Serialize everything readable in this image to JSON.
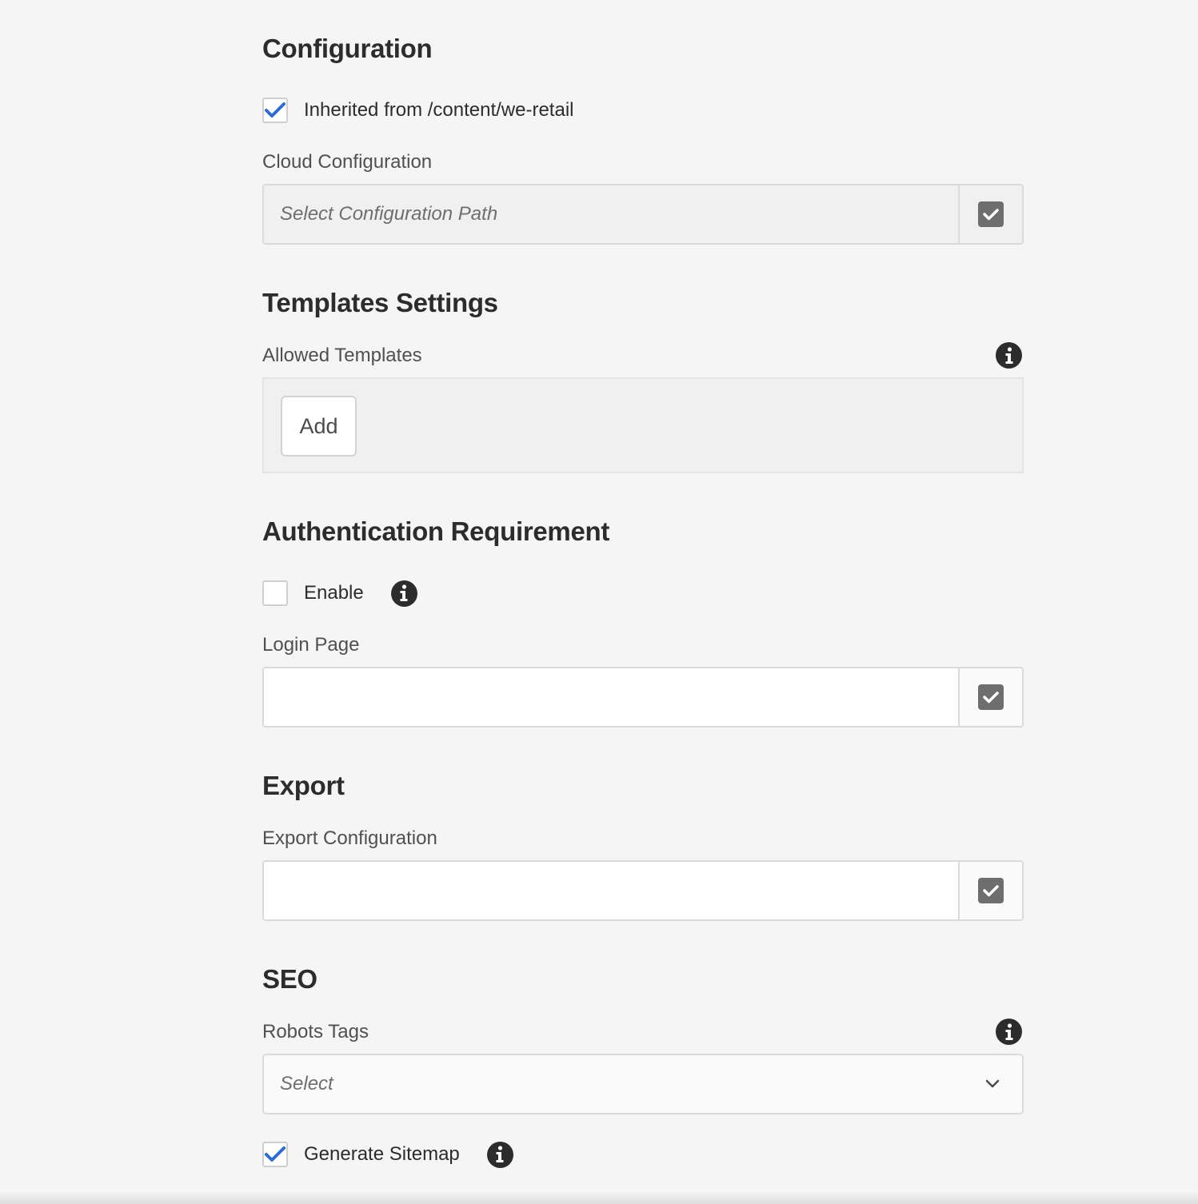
{
  "sections": {
    "configuration": {
      "title": "Configuration",
      "inherited_label": "Inherited from /content/we-retail",
      "inherited_checked": true,
      "cloud_config_label": "Cloud Configuration",
      "cloud_config_placeholder": "Select Configuration Path"
    },
    "templates": {
      "title": "Templates Settings",
      "allowed_templates_label": "Allowed Templates",
      "add_button_label": "Add"
    },
    "authentication": {
      "title": "Authentication Requirement",
      "enable_label": "Enable",
      "enable_checked": false,
      "login_page_label": "Login Page",
      "login_page_value": ""
    },
    "export": {
      "title": "Export",
      "export_config_label": "Export Configuration",
      "export_config_value": ""
    },
    "seo": {
      "title": "SEO",
      "robots_tags_label": "Robots Tags",
      "robots_tags_selected": "Select",
      "generate_sitemap_label": "Generate Sitemap",
      "generate_sitemap_checked": true
    }
  },
  "colors": {
    "background": "#f5f5f5",
    "checkmark_blue": "#2d6dd1",
    "text_dark": "#2c2c2c",
    "label_gray": "#505050",
    "picker_icon_gray": "#6e6e6e"
  },
  "icons": {
    "info": "info-icon",
    "checkbox_check": "checkmark-icon",
    "picker": "checkmark-square-icon",
    "dropdown": "chevron-down-icon"
  }
}
